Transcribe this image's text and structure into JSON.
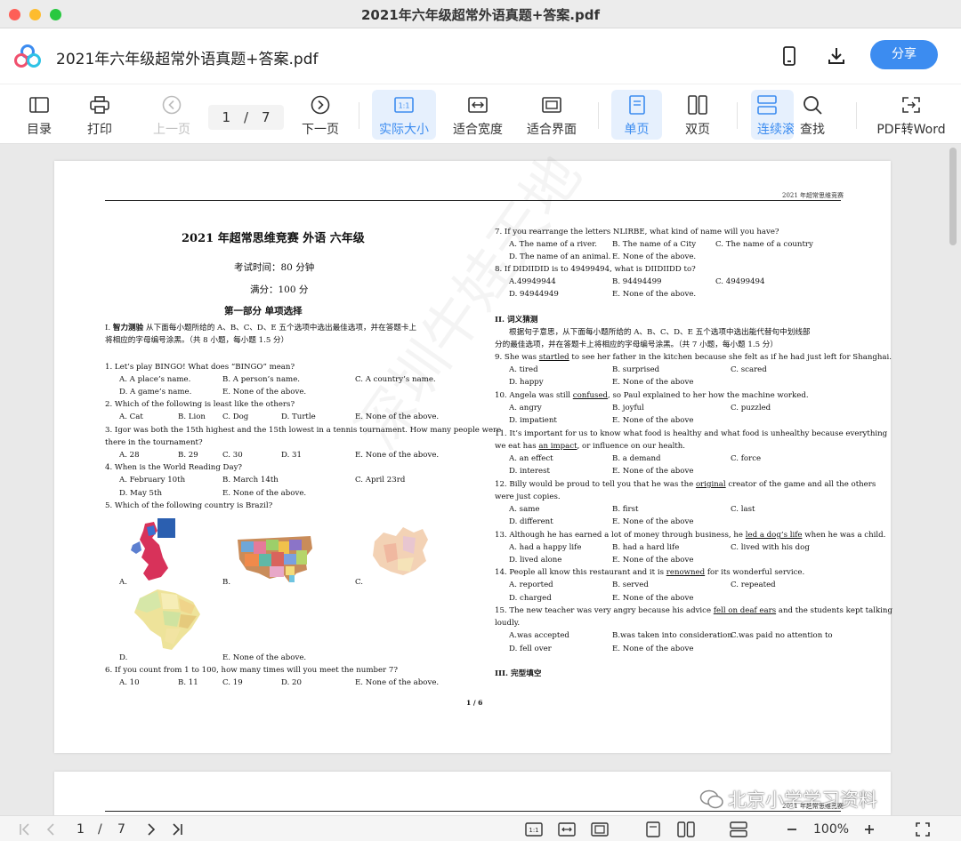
{
  "window": {
    "title": "2021年六年级超常外语真题+答案.pdf"
  },
  "header": {
    "doc_title": "2021年六年级超常外语真题+答案.pdf",
    "share_label": "分享"
  },
  "toolbar": {
    "toc": "目录",
    "print": "打印",
    "prev": "上一页",
    "page_current": "1",
    "page_sep": "/",
    "page_total": "7",
    "next": "下一页",
    "actual_size": "实际大小",
    "fit_width": "适合宽度",
    "fit_page": "适合界面",
    "single": "单页",
    "double": "双页",
    "continuous": "连续滚",
    "find": "查找",
    "pdf_to_word": "PDF转Word"
  },
  "doc": {
    "running_header": "2021 年超常思维竞赛",
    "title": "2021 年超常思维竞赛  外语  六年级",
    "time": "考试时间：80 分钟",
    "score": "满分：100 分",
    "part1": "第一部分      单项选择",
    "sec1_a": "I. ",
    "sec1_b": "智力测验",
    "sec1_c": "  从下面每小题所给的 A、B、C、D、E 五个选项中选出最佳选项，并在答题卡上",
    "sec1_d": "将相应的字母编号涂黑。（共 8 小题，每小题 1.5 分）",
    "q1": "1.  Let’s play BINGO! What does “BINGO” mean?",
    "q1a": "A. A place’s name.",
    "q1b": "B. A person’s name.",
    "q1c": "C. A country’s name.",
    "q1d": "D. A game’s name.",
    "q1e": "E. None of the above.",
    "q2": "2.  Which of the following is least like the others?",
    "q2a": "A. Cat",
    "q2b": "B. Lion",
    "q2c": "C. Dog",
    "q2d": "D. Turtle",
    "q2e": "E. None of the above.",
    "q3_1": "3.  Igor was both the 15th highest and the 15th lowest in a tennis tournament. How many people were",
    "q3_2": "there in the tournament?",
    "q3a": "A. 28",
    "q3b": "B. 29",
    "q3c": "C. 30",
    "q3d": "D. 31",
    "q3e": "E. None of the above.",
    "q4": "4.  When is the World Reading Day?",
    "q4a": "A. February 10th",
    "q4b": "B. March 14th",
    "q4c": "C. April 23rd",
    "q4d": "D. May 5th",
    "q4e": "E. None of the above.",
    "q5": "5.  Which of the following country is Brazil?",
    "q5a": "A.",
    "q5b": "B.",
    "q5c": "C.",
    "q5d": "D.",
    "q5e": "E.    None of the above.",
    "q6": "6.  If you count from 1 to 100, how many times will you meet the number 7?",
    "q6a": "A. 10",
    "q6b": "B. 11",
    "q6c": "C. 19",
    "q6d": "D. 20",
    "q6e": "E. None of the above.",
    "page_num": "1 / 6",
    "q7": "7.  If you rearrange the letters NLIRBE, what kind of name will you have?",
    "q7a": "A. The name of a river.",
    "q7b": "B. The name of a City",
    "q7c": "C. The name of a country",
    "q7d": "D. The name of an animal.",
    "q7e": "E. None of the above.",
    "q8": "8.  If DIDIIDID is to 49499494, what is DIIDIIDD to?",
    "q8a": "A.49949944",
    "q8b": "B. 94494499",
    "q8c": "C. 49499494",
    "q8d": "D. 94944949",
    "q8e": "E. None of the above.",
    "sec2": "II.  词义猜测",
    "sec2_1": "根据句子意思，从下面每小题所给的 A、B、C、D、E 五个选项中选出能代替句中划线部",
    "sec2_2": "分的最佳选项，并在答题卡上将相应的字母编号涂黑。（共 7 小题，每小题 1.5 分）",
    "q9_pre": "9.  She was ",
    "q9_u": "startled",
    "q9_post": " to see her father in the kitchen because she felt as if he had just left for Shanghai.",
    "q9a": "A. tired",
    "q9b": "B. surprised",
    "q9c": "C. scared",
    "q9d": "D. happy",
    "q9e": "E. None of the above",
    "q10_pre": "10.  Angela was still ",
    "q10_u": "confused",
    "q10_post": ", so Paul explained to her how the machine worked.",
    "q10a": "A. angry",
    "q10b": "B. joyful",
    "q10c": "C. puzzled",
    "q10d": "D. impatient",
    "q10e": "E. None of the above",
    "q11_1": "11.  It’s important for us to know what food is healthy and what food is unhealthy because everything",
    "q11_pre": "we eat has ",
    "q11_u": "an impact",
    "q11_post": ", or influence on our health.",
    "q11a": "A. an effect",
    "q11b": "B. a demand",
    "q11c": "C. force",
    "q11d": "D. interest",
    "q11e": "E. None of the above",
    "q12_pre": "12.  Billy would be proud to tell you that he was the ",
    "q12_u": "original",
    "q12_post": " creator of the game and all the others",
    "q12_2": "were just copies.",
    "q12a": "A. same",
    "q12b": "B. first",
    "q12c": "C. last",
    "q12d": "D. different",
    "q12e": "E. None of the above",
    "q13_pre": "13.  Although he has earned a lot of money through business, he ",
    "q13_u": "led a dog’s life",
    "q13_post": " when he was a child.",
    "q13a": "A. had a happy life",
    "q13b": "B. had a hard life",
    "q13c": "C. lived with his dog",
    "q13d": "D.  lived alone",
    "q13e": "E. None of the above",
    "q14_pre": "14.  People all know this restaurant and it is ",
    "q14_u": "renowned",
    "q14_post": " for its wonderful service.",
    "q14a": "A. reported",
    "q14b": "B. served",
    "q14c": "C. repeated",
    "q14d": "D. charged",
    "q14e": "E. None of the above",
    "q15_pre": "15.  The new teacher was very angry because his advice ",
    "q15_u": "fell on deaf ears",
    "q15_post": " and the students kept talking",
    "q15_2": "loudly.",
    "q15a": "A.was accepted",
    "q15b": "B.was taken into consideration",
    "q15c": "C.was paid no attention to",
    "q15d": "D. fell over",
    "q15e": "E. None of the above",
    "sec3": "III.  完型填空",
    "watermark": "深圳牛娃天地",
    "page2_header": "2021 年超常思维竞赛"
  },
  "bottombar": {
    "page_current": "1",
    "page_sep": "/",
    "page_total": "7",
    "zoom": "100%"
  },
  "overlay": {
    "wechat_watermark": "北京小学学习资料"
  },
  "colors": {
    "accent": "#3c8cf0",
    "active_bg": "#e6f0fd"
  }
}
